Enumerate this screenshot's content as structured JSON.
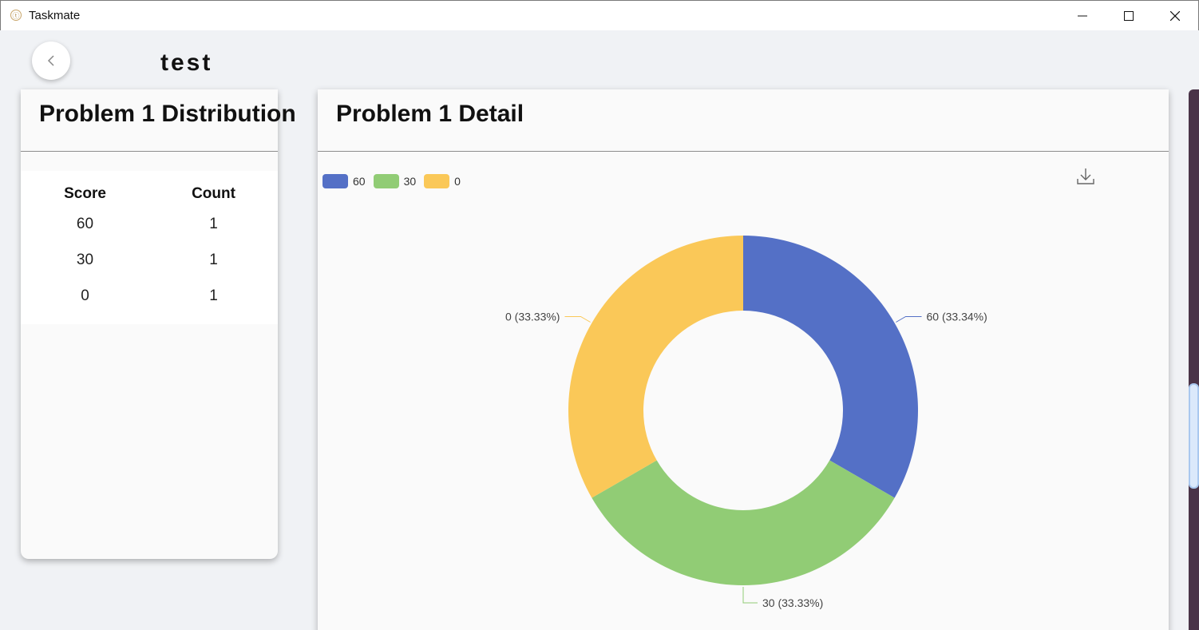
{
  "window": {
    "app_title": "Taskmate",
    "icon": "app-logo-icon"
  },
  "header": {
    "page_title": "test",
    "back_icon": "chevron-left-icon"
  },
  "distribution": {
    "title": "Problem 1 Distribution",
    "columns": [
      "Score",
      "Count"
    ],
    "rows": [
      [
        "60",
        "1"
      ],
      [
        "30",
        "1"
      ],
      [
        "0",
        "1"
      ]
    ]
  },
  "detail": {
    "title": "Problem 1 Detail",
    "download_icon": "download-icon"
  },
  "chart_data": {
    "type": "pie",
    "donut": true,
    "categories": [
      "60",
      "30",
      "0"
    ],
    "values": [
      1,
      1,
      1
    ],
    "slice_labels": [
      "60 (33.34%)",
      "30 (33.33%)",
      "0 (33.33%)"
    ],
    "colors": [
      "#5470c6",
      "#91cc75",
      "#fac858"
    ],
    "legend_position": "top-left"
  }
}
